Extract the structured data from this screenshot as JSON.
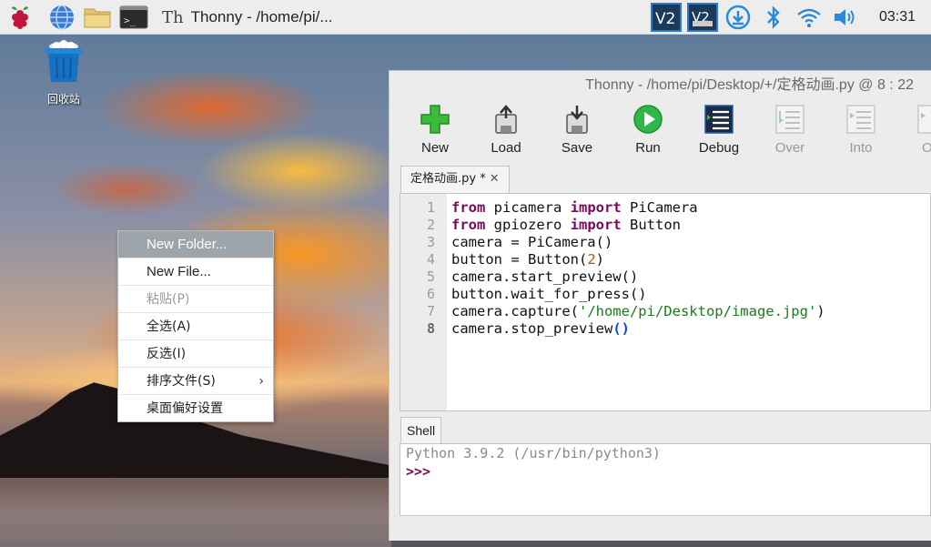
{
  "taskbar": {
    "app_task_label": "Thonny  -  /home/pi/...",
    "app_task_icon_text": "Th",
    "clock": "03:31",
    "vnc_label": "V2"
  },
  "desktop": {
    "trash_label": "回收站"
  },
  "context_menu": {
    "items": [
      {
        "label": "New Folder...",
        "state": "highlighted"
      },
      {
        "label": "New File...",
        "state": "normal"
      },
      {
        "label": "粘贴(P)",
        "state": "disabled"
      },
      {
        "label": "全选(A)",
        "state": "normal"
      },
      {
        "label": "反选(I)",
        "state": "normal"
      },
      {
        "label": "排序文件(S)",
        "state": "normal",
        "submenu": true
      },
      {
        "label": "桌面偏好设置",
        "state": "normal"
      }
    ],
    "submenu_arrow": "›"
  },
  "thonny": {
    "title": "Thonny  -  /home/pi/Desktop/+/定格动画.py  @  8 : 22",
    "toolbar": [
      {
        "label": "New",
        "icon": "new-icon"
      },
      {
        "label": "Load",
        "icon": "load-icon"
      },
      {
        "label": "Save",
        "icon": "save-icon"
      },
      {
        "label": "Run",
        "icon": "run-icon"
      },
      {
        "label": "Debug",
        "icon": "debug-icon"
      },
      {
        "label": "Over",
        "icon": "step-over-icon",
        "disabled": true
      },
      {
        "label": "Into",
        "icon": "step-into-icon",
        "disabled": true
      },
      {
        "label": "O",
        "icon": "step-out-icon",
        "disabled": true
      }
    ],
    "editor_tab": {
      "label": "定格动画.py *",
      "close": "✕"
    },
    "line_numbers": [
      "1",
      "2",
      "3",
      "4",
      "5",
      "6",
      "7",
      "8"
    ],
    "code_lines": [
      "from picamera import PiCamera",
      "from gpiozero import Button",
      "camera = PiCamera()",
      "button = Button(2)",
      "camera.start_preview()",
      "button.wait_for_press()",
      "camera.capture('/home/pi/Desktop/image.jpg')",
      "camera.stop_preview()"
    ],
    "code_tokens": {
      "l1": {
        "kw1": "from",
        "a": " picamera ",
        "kw2": "import",
        "b": " PiCamera"
      },
      "l2": {
        "kw1": "from",
        "a": " gpiozero ",
        "kw2": "import",
        "b": " Button"
      },
      "l3": "camera = PiCamera()",
      "l4": {
        "a": "button = Button(",
        "num": "2",
        "b": ")"
      },
      "l5": "camera.start_preview()",
      "l6": "button.wait_for_press()",
      "l7": {
        "a": "camera.capture(",
        "str": "'/home/pi/Desktop/image.jpg'",
        "b": ")"
      },
      "l8": {
        "a": "camera.stop_preview",
        "paren": "()"
      }
    },
    "shell_tab": "Shell",
    "shell_info": "Python 3.9.2 (/usr/bin/python3)",
    "shell_prompt": ">>>"
  },
  "colors": {
    "keyword": "#7a0a5a",
    "number": "#b05a00",
    "string": "#1c7a1c",
    "paren_highlight": "#1a44d8",
    "menu_highlight": "#9da4aa"
  }
}
